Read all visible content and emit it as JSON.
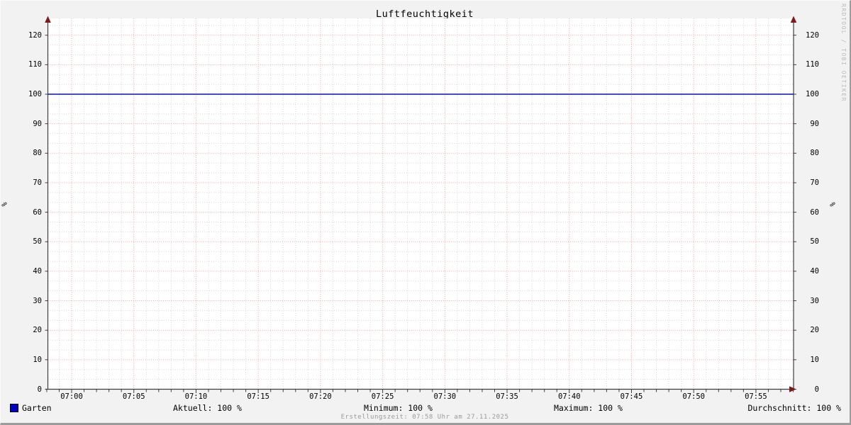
{
  "title": "Luftfeuchtigkeit",
  "watermark": "RRDTOOL / TOBI OETIKER",
  "footer": "Erstellungszeit: 07:58 Uhr am 27.11.2025",
  "y_axis": {
    "unit": "%"
  },
  "legend": {
    "series_label": "Garten",
    "stats": [
      {
        "label": "Aktuell",
        "value": "100 %",
        "display": "Aktuell: 100 %"
      },
      {
        "label": "Minimum",
        "value": "100 %",
        "display": "Minimum: 100 %"
      },
      {
        "label": "Maximum",
        "value": "100 %",
        "display": "Maximum: 100 %"
      },
      {
        "label": "Durchschnitt",
        "value": "100 %",
        "display": "Durchschnitt: 100 %"
      }
    ]
  },
  "colors": {
    "background": "#f2f2f2",
    "canvas": "#ffffff",
    "axis": "#3f3f3f",
    "arrow": "#801a1a",
    "grid_major": "#f0a8a8",
    "grid_minor": "#d6d6d6",
    "series_line": "#0b0bc0",
    "legend_swatch": "#0000cc",
    "watermark_text": "#bcbcbc",
    "footer_text": "#9a9a9a"
  },
  "chart_data": {
    "type": "line",
    "title": "Luftfeuchtigkeit",
    "xlabel": "",
    "ylabel": "%",
    "ylim": [
      0,
      125.7
    ],
    "y_ticks": [
      0,
      10,
      20,
      30,
      40,
      50,
      60,
      70,
      80,
      90,
      100,
      110,
      120
    ],
    "y_minor_step": 3.3333,
    "x_ticks": [
      "07:00",
      "07:05",
      "07:10",
      "07:15",
      "07:20",
      "07:25",
      "07:30",
      "07:35",
      "07:40",
      "07:45",
      "07:50",
      "07:55"
    ],
    "x_minor_per_major": 5,
    "grid": true,
    "legend_position": "bottom",
    "series": [
      {
        "name": "Garten",
        "color": "#0b0bc0",
        "x": [
          "07:00",
          "07:05",
          "07:10",
          "07:15",
          "07:20",
          "07:25",
          "07:30",
          "07:35",
          "07:40",
          "07:45",
          "07:50",
          "07:55"
        ],
        "values": [
          100,
          100,
          100,
          100,
          100,
          100,
          100,
          100,
          100,
          100,
          100,
          100
        ]
      }
    ],
    "stats": {
      "aktuell": 100,
      "minimum": 100,
      "maximum": 100,
      "durchschnitt": 100,
      "unit": "%"
    }
  }
}
